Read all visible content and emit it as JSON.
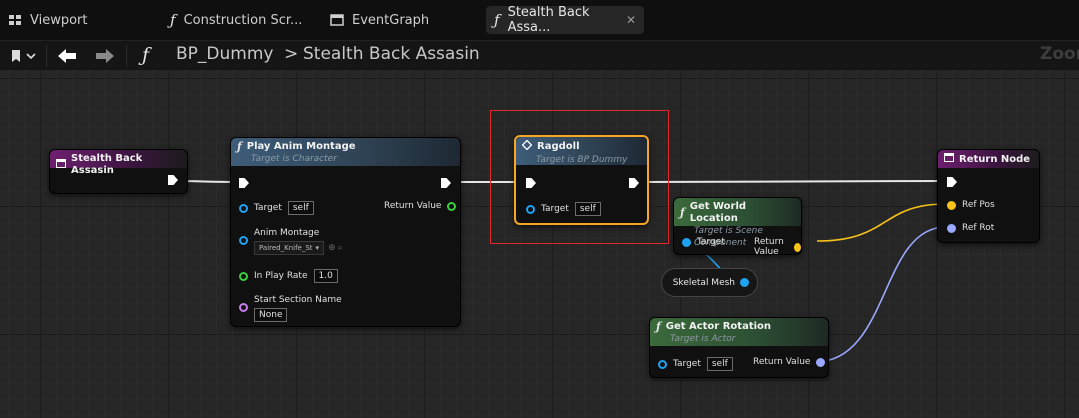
{
  "tabs": [
    {
      "label": "Viewport",
      "icon": "grid-icon"
    },
    {
      "label": "Construction Scr...",
      "icon": "function-icon"
    },
    {
      "label": "EventGraph",
      "icon": "event-graph-icon"
    },
    {
      "label": "Stealth Back Assa...",
      "icon": "function-icon",
      "active": true
    }
  ],
  "breadcrumb": {
    "blueprint": "BP_Dummy",
    "separator": ">",
    "graph": "Stealth Back Assasin",
    "zoom": "Zoom"
  },
  "nodes": {
    "entry": {
      "title": "Stealth Back Assasin"
    },
    "play_anim": {
      "title": "Play Anim Montage",
      "subtitle": "Target is Character",
      "target_label": "Target",
      "target_value": "self",
      "return_label": "Return Value",
      "anim_montage_label": "Anim Montage",
      "anim_montage_value": "Paired_Knife_St",
      "in_play_rate_label": "In Play Rate",
      "in_play_rate_value": "1.0",
      "start_section_label": "Start Section Name",
      "start_section_value": "None"
    },
    "ragdoll": {
      "title": "Ragdoll",
      "subtitle": "Target is BP Dummy",
      "target_label": "Target",
      "target_value": "self"
    },
    "get_world_location": {
      "title": "Get World Location",
      "subtitle": "Target is Scene Component",
      "target_label": "Target",
      "return_label": "Return Value"
    },
    "skeletal_mesh": {
      "label": "Skeletal Mesh"
    },
    "get_actor_rotation": {
      "title": "Get Actor Rotation",
      "subtitle": "Target is Actor",
      "target_label": "Target",
      "target_value": "self",
      "return_label": "Return Value"
    },
    "return_node": {
      "title": "Return Node",
      "ref_pos_label": "Ref Pos",
      "ref_rot_label": "Ref Rot"
    }
  },
  "colors": {
    "object_pin": "#1fa3f2",
    "vector_pin": "#f7c21a",
    "rotator_pin": "#9aa8ff",
    "float_pin": "#38d13c",
    "name_pin": "#c87cf0",
    "selection": "#f5a623",
    "highlight_box": "#e0282c"
  }
}
